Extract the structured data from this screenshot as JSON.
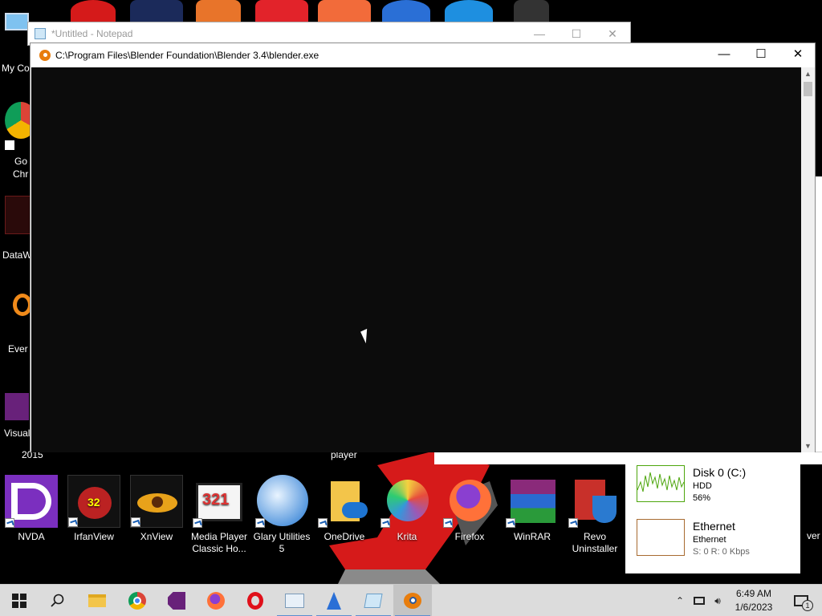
{
  "desktop": {
    "left_labels": [
      "My Co",
      "Go",
      "Chr",
      "DataW",
      "Ever",
      "Visual",
      "2015"
    ],
    "bottom_icons": [
      {
        "label": "NVDA",
        "color": "#7b2fbf"
      },
      {
        "label": "IrfanView",
        "color": "#8b1a1a"
      },
      {
        "label": "XnView",
        "color": "#d07b12"
      },
      {
        "label": "Media Player Classic Ho...",
        "color": "#3a3a3a"
      },
      {
        "label": "Glary Utilities 5",
        "color": "#1e74d1"
      },
      {
        "label": "OneDrive",
        "color": "#f3c54a"
      },
      {
        "label": "Krita",
        "color": "#d23a7a"
      },
      {
        "label": "Firefox",
        "color": "#ff7139"
      },
      {
        "label": "WinRAR",
        "color": "#8a2a7a"
      },
      {
        "label": "Revo Uninstaller",
        "color": "#c8302a"
      }
    ],
    "player_label": "player",
    "right_edge_label": "ver"
  },
  "notepad": {
    "title": "*Untitled - Notepad"
  },
  "console": {
    "title": "C:\\Program Files\\Blender Foundation\\Blender 3.4\\blender.exe"
  },
  "window_buttons": {
    "minimize": "—",
    "maximize": "☐",
    "close": "✕"
  },
  "task_manager": {
    "disk": {
      "name": "Disk 0 (C:)",
      "type": "HDD",
      "value": "56%"
    },
    "ethernet": {
      "name": "Ethernet",
      "type": "Ethernet",
      "value": "S: 0 R: 0 Kbps"
    }
  },
  "clock": {
    "time": "6:49 AM",
    "date": "1/6/2023"
  },
  "notification_count": "1",
  "colors": {
    "accent": "#5a8ed0",
    "taskbar": "#dcdcdc",
    "console_bg": "#0c0c0c"
  }
}
